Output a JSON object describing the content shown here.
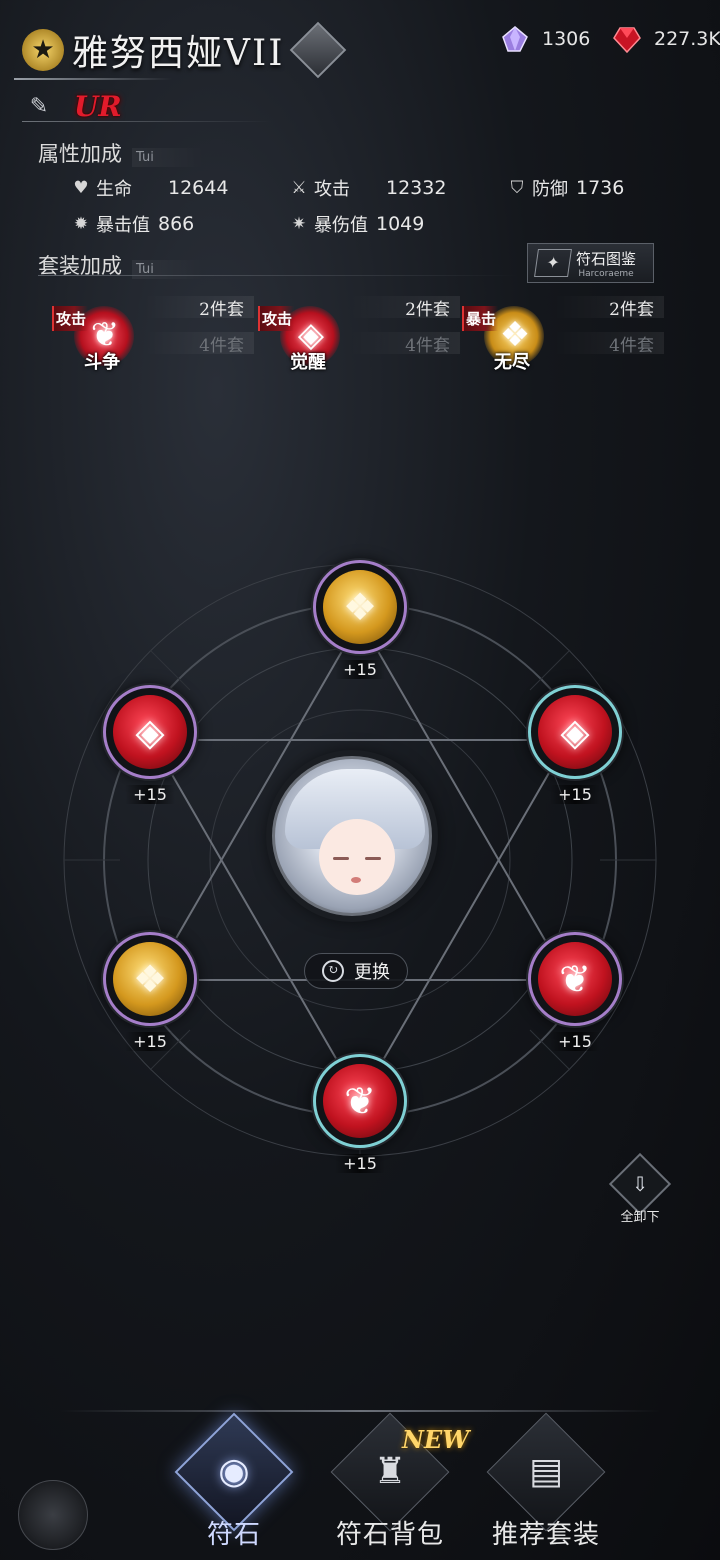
{
  "hero": {
    "name": "雅努西娅VII",
    "rarity": "UR"
  },
  "currency": [
    {
      "icon": "purple-crystal-icon",
      "value": "1306"
    },
    {
      "icon": "red-gem-icon",
      "value": "227.3K"
    }
  ],
  "attributes": {
    "title": "属性加成",
    "subtitle": "Tui",
    "stats": [
      {
        "icon": "heart-icon",
        "label": "生命",
        "value": "12644"
      },
      {
        "icon": "sword-icon",
        "label": "攻击",
        "value": "12332"
      },
      {
        "icon": "shield-icon",
        "label": "防御",
        "value": "1736"
      },
      {
        "icon": "crit-icon",
        "label": "暴击值",
        "value": "866"
      },
      {
        "icon": "crit-damage-icon",
        "label": "暴伤值",
        "value": "1049"
      }
    ]
  },
  "set_bonus": {
    "title": "套装加成",
    "subtitle": "Tui",
    "codex": {
      "label": "符石图鉴",
      "sub": "Harcoraeme"
    },
    "sets": [
      {
        "tag": "攻击",
        "name": "斗争",
        "two": "2件套",
        "four": "4件套",
        "color": "red",
        "icon": "tree-icon"
      },
      {
        "tag": "攻击",
        "name": "觉醒",
        "two": "2件套",
        "four": "4件套",
        "color": "red",
        "icon": "flame-diamond-icon"
      },
      {
        "tag": "暴击",
        "name": "无尽",
        "two": "2件套",
        "four": "4件套",
        "color": "gold",
        "icon": "fang-icon"
      }
    ]
  },
  "slots": [
    {
      "pos": "top",
      "color": "gold",
      "icon": "fang-icon",
      "level": "+15",
      "frame": "purple"
    },
    {
      "pos": "upper-left",
      "color": "red",
      "icon": "flame-diamond-icon",
      "level": "+15",
      "frame": "purple"
    },
    {
      "pos": "upper-right",
      "color": "red",
      "icon": "flame-diamond-icon",
      "level": "+15",
      "frame": "teal"
    },
    {
      "pos": "lower-left",
      "color": "gold",
      "icon": "fang-icon",
      "level": "+15",
      "frame": "purple"
    },
    {
      "pos": "lower-right",
      "color": "red",
      "icon": "tree-icon",
      "level": "+15",
      "frame": "purple"
    },
    {
      "pos": "bottom",
      "color": "red",
      "icon": "tree-icon",
      "level": "+15",
      "frame": "teal"
    }
  ],
  "swap_label": "更换",
  "unequip_label": "全卸下",
  "nav": [
    {
      "label": "符石",
      "active": true,
      "icon": "rune-eye-icon"
    },
    {
      "label": "符石背包",
      "active": false,
      "icon": "backpack-icon",
      "badge": "NEW"
    },
    {
      "label": "推荐套装",
      "active": false,
      "icon": "cards-icon"
    }
  ],
  "colors": {
    "accent_red": "#e21b2b",
    "accent_gold": "#d4981e",
    "accent_purple": "#a57ec9",
    "accent_teal": "#7fd0d4",
    "nav_active": "#8fa4d8"
  }
}
